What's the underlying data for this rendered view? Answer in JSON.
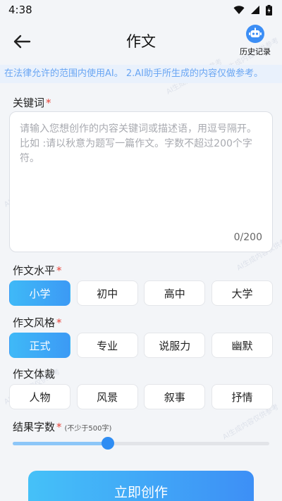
{
  "status_bar": {
    "time": "4:38"
  },
  "header": {
    "title": "作文",
    "history_label": "历史记录"
  },
  "notice": {
    "text": "在法律允许的范围内使用AI。 2.AI助手所生成的内容仅做参考。"
  },
  "keywords": {
    "label": "关键词",
    "required_mark": "*",
    "placeholder": "请输入您想创作的内容关键词或描述语，用逗号隔开。比如 :请以秋意为题写一篇作文。字数不超过200个字符。",
    "value": "",
    "count": "0/200"
  },
  "level": {
    "label": "作文水平",
    "required_mark": "*",
    "options": [
      "小学",
      "初中",
      "高中",
      "大学"
    ],
    "selected": "小学"
  },
  "style": {
    "label": "作文风格",
    "required_mark": "*",
    "options": [
      "正式",
      "专业",
      "说服力",
      "幽默"
    ],
    "selected": "正式"
  },
  "genre": {
    "label": "作文体裁",
    "options": [
      "人物",
      "风景",
      "叙事",
      "抒情"
    ],
    "selected": ""
  },
  "word_count": {
    "label": "结果字数",
    "required_mark": "*",
    "hint": "(不少于500字)",
    "fraction": 0.37
  },
  "submit": {
    "label": "立即创作"
  },
  "watermark": {
    "text": "AI生成内容仅供参考"
  },
  "colors": {
    "accent": "#3c9af5",
    "required": "#e8443a",
    "notice_text": "#6aa6f3"
  }
}
